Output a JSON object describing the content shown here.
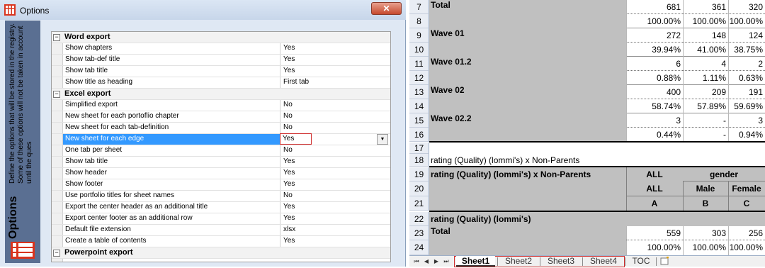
{
  "dialog": {
    "title": "Options",
    "close_label": "✕",
    "side_title": "Options",
    "side_description": "Define the options that will be stored in the registry. Some of these options will not be taken in account until the ques"
  },
  "categories": [
    {
      "name": "Word export",
      "expander": "−",
      "items": [
        {
          "name": "Show chapters",
          "value": "Yes"
        },
        {
          "name": "Show tab-def title",
          "value": "Yes"
        },
        {
          "name": "Show tab title",
          "value": "Yes"
        },
        {
          "name": "Show title as heading",
          "value": "First tab"
        }
      ]
    },
    {
      "name": "Excel export",
      "expander": "−",
      "items": [
        {
          "name": "Simplified export",
          "value": "No"
        },
        {
          "name": "New sheet for each portoflio chapter",
          "value": "No"
        },
        {
          "name": "New sheet for each tab-definition",
          "value": "No"
        },
        {
          "name": "New sheet for each edge",
          "value": "Yes"
        },
        {
          "name": "One tab per sheet",
          "value": "No"
        },
        {
          "name": "Show tab title",
          "value": "Yes"
        },
        {
          "name": "Show header",
          "value": "Yes"
        },
        {
          "name": "Show footer",
          "value": "Yes"
        },
        {
          "name": "Use portfolio titles for sheet names",
          "value": "No"
        },
        {
          "name": "Export the center header as an additional title",
          "value": "Yes"
        },
        {
          "name": "Export center footer as an additional row",
          "value": "Yes"
        },
        {
          "name": "Default file extension",
          "value": "xlsx"
        },
        {
          "name": "Create a table of contents",
          "value": "Yes"
        }
      ]
    },
    {
      "name": "Powerpoint export",
      "expander": "−",
      "items": []
    }
  ],
  "selected_item": "New sheet for each edge",
  "dropdown_glyph": "▼",
  "sheet": {
    "rows": [
      {
        "num": "7",
        "label": "Total",
        "a": "681",
        "b": "361",
        "c": "320"
      },
      {
        "num": "8",
        "label": "",
        "a": "100.00%",
        "b": "100.00%",
        "c": "100.00%"
      },
      {
        "num": "9",
        "label": "Wave 01",
        "a": "272",
        "b": "148",
        "c": "124"
      },
      {
        "num": "10",
        "label": "",
        "a": "39.94%",
        "b": "41.00%",
        "c": "38.75%"
      },
      {
        "num": "11",
        "label": "Wave 01.2",
        "a": "6",
        "b": "4",
        "c": "2"
      },
      {
        "num": "12",
        "label": "",
        "a": "0.88%",
        "b": "1.11%",
        "c": "0.63%"
      },
      {
        "num": "13",
        "label": "Wave 02",
        "a": "400",
        "b": "209",
        "c": "191"
      },
      {
        "num": "14",
        "label": "",
        "a": "58.74%",
        "b": "57.89%",
        "c": "59.69%"
      },
      {
        "num": "15",
        "label": "Wave 02.2",
        "a": "3",
        "b": "-",
        "c": "3"
      },
      {
        "num": "16",
        "label": "",
        "a": "0.44%",
        "b": "-",
        "c": "0.94%"
      }
    ],
    "row17": "17",
    "row18": {
      "num": "18",
      "text": "rating (Quality) (lommi's) x Non-Parents"
    },
    "header": {
      "r19": "19",
      "r20": "20",
      "r21": "21",
      "table_title": "rating (Quality) (lommi's) x Non-Parents",
      "all": "ALL",
      "gender": "gender",
      "all2": "ALL",
      "male": "Male",
      "female": "Female",
      "col_a": "A",
      "col_b": "B",
      "col_c": "C"
    },
    "row22": {
      "num": "22",
      "text": "rating (Quality) (lommi's)"
    },
    "row23": {
      "num": "23",
      "label": "Total",
      "a": "559",
      "b": "303",
      "c": "256"
    },
    "row24": {
      "num": "24",
      "a": "100.00%",
      "b": "100.00%",
      "c": "100.00%"
    }
  },
  "tabs": [
    "Sheet1",
    "Sheet2",
    "Sheet3",
    "Sheet4",
    "TOC"
  ],
  "active_tab": "Sheet1",
  "nav": {
    "first": "⏮",
    "prev": "◀",
    "next": "▶",
    "last": "⏭"
  },
  "colors": {
    "selection": "#3399ff",
    "highlight_border": "#d03030",
    "shade": "#c0c0c0",
    "side_panel": "#5a6f92"
  }
}
